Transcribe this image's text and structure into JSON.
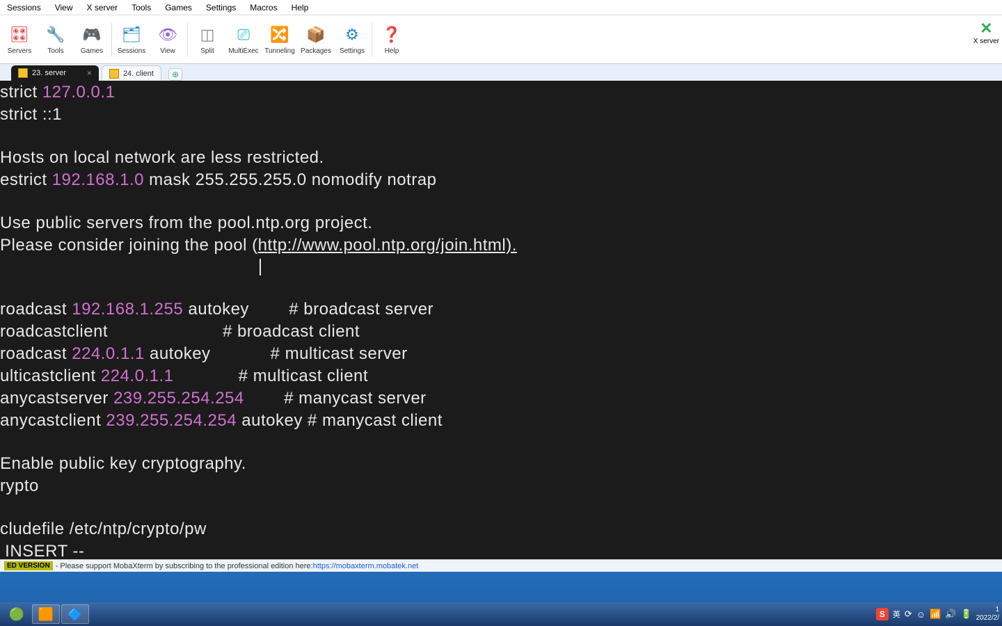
{
  "menu": {
    "items": [
      "Sessions",
      "View",
      "X server",
      "Tools",
      "Games",
      "Settings",
      "Macros",
      "Help"
    ]
  },
  "toolbar": {
    "items": [
      {
        "label": "Servers",
        "glyph": "🎛",
        "cls": "ic-red"
      },
      {
        "label": "Tools",
        "glyph": "🔧",
        "cls": "ic-orange"
      },
      {
        "label": "Games",
        "glyph": "🎮",
        "cls": "ic-green"
      },
      {
        "label": "Sessions",
        "glyph": "🗂",
        "cls": "ic-blue"
      },
      {
        "label": "View",
        "glyph": "👁",
        "cls": "ic-purple"
      },
      {
        "label": "Split",
        "glyph": "◫",
        "cls": "ic-gray"
      },
      {
        "label": "MultiExec",
        "glyph": "⎚",
        "cls": "ic-cyan"
      },
      {
        "label": "Tunneling",
        "glyph": "🔀",
        "cls": "ic-yellow"
      },
      {
        "label": "Packages",
        "glyph": "📦",
        "cls": "ic-orange"
      },
      {
        "label": "Settings",
        "glyph": "⚙",
        "cls": "ic-blue"
      },
      {
        "label": "Help",
        "glyph": "❓",
        "cls": "ic-blue"
      }
    ],
    "right": {
      "label": "X server",
      "glyph": "✕",
      "cls": "ic-green"
    }
  },
  "tabs": {
    "active": {
      "label": "23. server"
    },
    "inactive": {
      "label": "24. client"
    }
  },
  "terminal": {
    "l1a": "strict ",
    "l1b": "127.0.0.1",
    "l2": "strict ::1",
    "l4": "Hosts on local network are less restricted.",
    "l5a": "estrict ",
    "l5b": "192.168.1.0",
    "l5c": " mask 255.255.255.0 nomodify notrap",
    "l7": "Use public servers from the pool.ntp.org project.",
    "l8a": "Please consider joining the pool (",
    "l8b": "http://www.pool.ntp.org/join.html).",
    "l10a": "roadcast ",
    "l10b": "192.168.1.255",
    "l10c": " autokey        # broadcast server",
    "l11": "roadcastclient                       # broadcast client",
    "l12a": "roadcast ",
    "l12b": "224.0.1.1",
    "l12c": " autokey            # multicast server",
    "l13a": "ulticastclient ",
    "l13b": "224.0.1.1",
    "l13c": "             # multicast client",
    "l14a": "anycastserver ",
    "l14b": "239.255.254.254",
    "l14c": "        # manycast server",
    "l15a": "anycastclient ",
    "l15b": "239.255.254.254",
    "l15c": " autokey # manycast client",
    "l17": "Enable public key cryptography.",
    "l18": "rypto",
    "l20": "cludefile /etc/ntp/crypto/pw",
    "l21": " INSERT --"
  },
  "footer": {
    "badge": "ED VERSION",
    "text": " -  Please support MobaXterm by subscribing to the professional edition here: ",
    "link": "https://mobaxterm.mobatek.net"
  },
  "tray": {
    "ime": "英",
    "time1": "1",
    "time2": "2022/2/"
  }
}
